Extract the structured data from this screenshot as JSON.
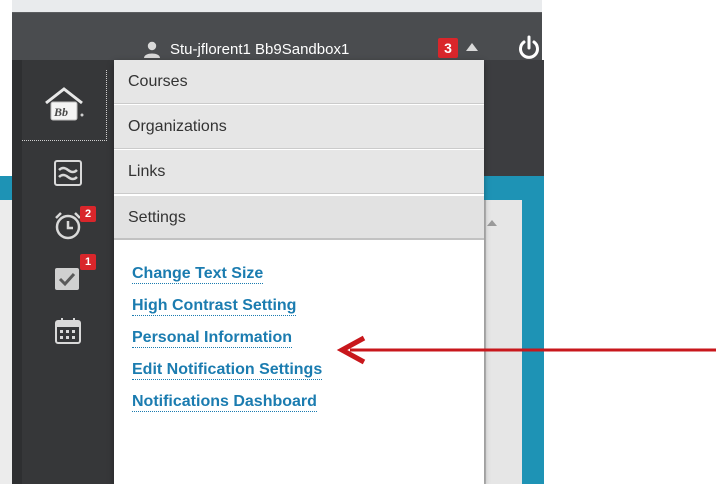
{
  "header": {
    "user_name": "Stu-jflorent1 Bb9Sandbox1",
    "notification_count": "3"
  },
  "sidebar": {
    "items": [
      {
        "icon": "home-bb-icon",
        "badge": ""
      },
      {
        "icon": "stream-icon",
        "badge": ""
      },
      {
        "icon": "alarm-clock-icon",
        "badge": "2"
      },
      {
        "icon": "grades-check-icon",
        "badge": "1"
      },
      {
        "icon": "calendar-icon",
        "badge": ""
      }
    ]
  },
  "menu": {
    "sections": [
      "Courses",
      "Organizations",
      "Links",
      "Settings"
    ],
    "settings_links": [
      "Change Text Size",
      "High Contrast Setting",
      "Personal Information",
      "Edit Notification Settings",
      "Notifications Dashboard"
    ]
  },
  "colors": {
    "header_bg": "#4a4c4f",
    "sidebar_bg": "#363739",
    "badge_red": "#d9262b",
    "link_blue": "#1b7cb0",
    "annotation_arrow": "#c8171c",
    "accent_teal": "#1e93b5"
  }
}
